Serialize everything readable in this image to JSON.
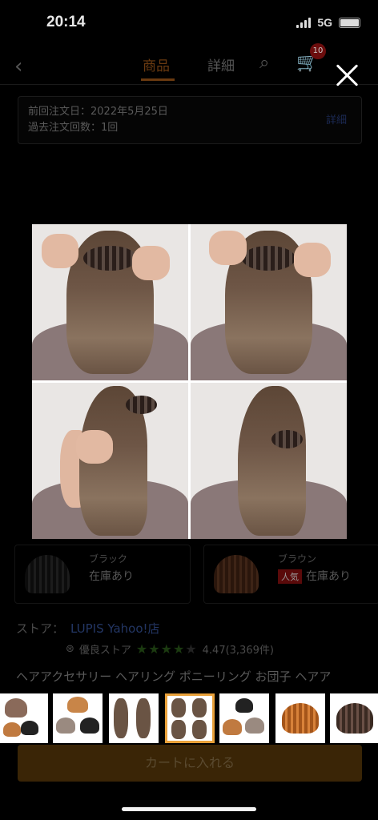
{
  "status_bar": {
    "time": "20:14",
    "network": "5G"
  },
  "nav": {
    "tabs": [
      {
        "label": "商品",
        "active": true
      },
      {
        "label": "詳細",
        "active": false
      }
    ],
    "cart_count": "10"
  },
  "order_info": {
    "last_order": "前回注文日：2022年5月25日",
    "past_count": "過去注文回数：1回",
    "detail_link": "詳細"
  },
  "variants": [
    {
      "name": "ブラック",
      "stock": "在庫あり",
      "badge": ""
    },
    {
      "name": "ブラウン",
      "stock": "在庫あり",
      "badge": "人気"
    }
  ],
  "store": {
    "label": "ストア：",
    "name": "LUPIS Yahoo!店",
    "badge": "優良ストア",
    "rating_text": "4.47(3,369件)",
    "rating": 4.47
  },
  "product_title": "ヘアアクセサリー ヘアリング ポニーリング お団子 ヘアア",
  "cart_button": "カートに入れる",
  "viewer": {
    "thumbnail_count": 7,
    "selected_index": 3
  },
  "colors": {
    "accent": "#e9a13a",
    "brand_orange": "#d86f1a"
  }
}
